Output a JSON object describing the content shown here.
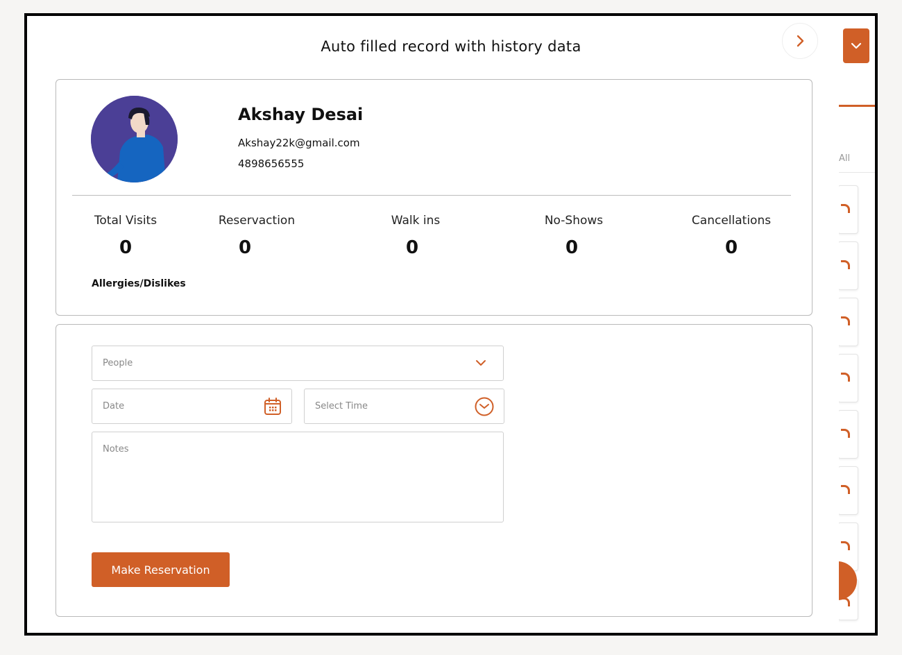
{
  "modal": {
    "title": "Auto filled record with history data"
  },
  "profile": {
    "name": "Akshay Desai",
    "email": "Akshay22k@gmail.com",
    "phone": "4898656555"
  },
  "stats": [
    {
      "label": "Total Visits",
      "value": "0"
    },
    {
      "label": "Reservaction",
      "value": "0"
    },
    {
      "label": "Walk ins",
      "value": "0"
    },
    {
      "label": "No-Shows",
      "value": "0"
    },
    {
      "label": "Cancellations",
      "value": "0"
    }
  ],
  "allergies_label": "Allergies/Dislikes",
  "form": {
    "people_placeholder": "People",
    "date_placeholder": "Date",
    "time_placeholder": "Select Time",
    "notes_placeholder": "Notes",
    "submit_label": "Make Reservation"
  },
  "background": {
    "filter_all": "All"
  },
  "colors": {
    "accent": "#d05f27",
    "avatar_bg": "#4b3f96",
    "border": "#b9b9b9"
  },
  "icons": {
    "next": "chevron-right-icon",
    "dropdown": "chevron-down-icon",
    "date": "calendar-icon",
    "time": "clock-icon"
  }
}
